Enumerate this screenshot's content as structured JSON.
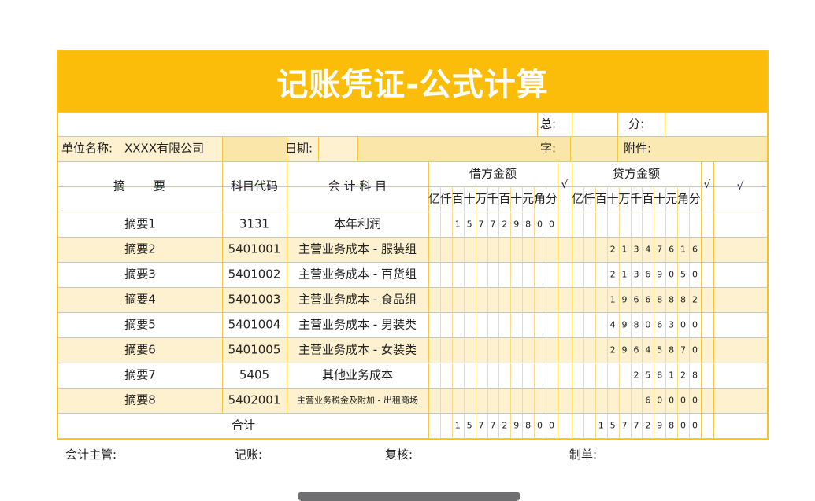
{
  "title": "记账凭证-公式计算",
  "info": {
    "zong_label": "总:",
    "fen_label": "分:",
    "unit_label": "单位名称:",
    "unit_value": "XXXX有限公司",
    "date_label": "日期:",
    "zi_label": "字:",
    "attach_label": "附件:"
  },
  "headers": {
    "summary": "摘　　要",
    "code": "科目代码",
    "subject": "会 计 科 目",
    "debit": "借方金额",
    "credit": "贷方金额",
    "check": "√",
    "units": [
      "亿",
      "仟",
      "百",
      "十",
      "万",
      "千",
      "百",
      "十",
      "元",
      "角",
      "分"
    ]
  },
  "rows": [
    {
      "summary": "摘要1",
      "code": "3131",
      "subject": "本年利润",
      "debit": "157729800",
      "credit": ""
    },
    {
      "summary": "摘要2",
      "code": "5401001",
      "subject": "主营业务成本 - 服装组",
      "debit": "",
      "credit": "21347616"
    },
    {
      "summary": "摘要3",
      "code": "5401002",
      "subject": "主营业务成本 - 百货组",
      "debit": "",
      "credit": "21369050"
    },
    {
      "summary": "摘要4",
      "code": "5401003",
      "subject": "主营业务成本 - 食品组",
      "debit": "",
      "credit": "19668882"
    },
    {
      "summary": "摘要5",
      "code": "5401004",
      "subject": "主营业务成本 - 男装类",
      "debit": "",
      "credit": "49806300"
    },
    {
      "summary": "摘要6",
      "code": "5401005",
      "subject": "主营业务成本 - 女装类",
      "debit": "",
      "credit": "29645870"
    },
    {
      "summary": "摘要7",
      "code": "5405",
      "subject": "其他业务成本",
      "debit": "",
      "credit": "258128"
    },
    {
      "summary": "摘要8",
      "code": "5402001",
      "subject": "主营业务税金及附加 - 出租商场",
      "debit": "",
      "credit": "60000"
    }
  ],
  "total": {
    "label": "合计",
    "debit": "157729800",
    "credit": "157729800"
  },
  "signatures": [
    "会计主管:",
    "记账:",
    "复核:",
    "制单:"
  ]
}
